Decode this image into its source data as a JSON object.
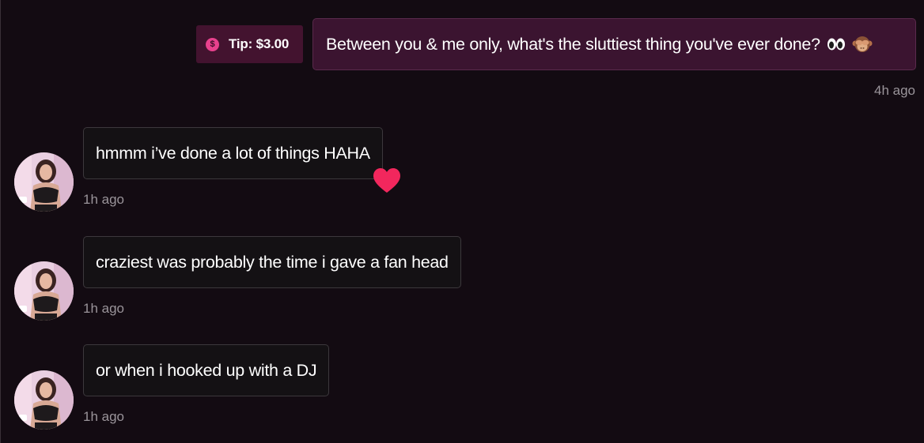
{
  "outgoing": {
    "tip_label": "Tip: $3.00",
    "tip_icon": "dollar-coin-icon",
    "message": "Between you & me only, what's the sluttiest thing you've ever done?",
    "emojis": [
      "eyes-emoji",
      "see-no-evil-monkey-emoji"
    ],
    "time": "4h ago"
  },
  "incoming": [
    {
      "text": "hmmm i’ve done a lot of things HAHA",
      "time": "1h ago",
      "reaction": "heart-icon"
    },
    {
      "text": "craziest was probably the time i gave a fan head",
      "time": "1h ago"
    },
    {
      "text": "or when i hooked up with a DJ",
      "time": "1h ago"
    }
  ],
  "colors": {
    "background": "#130b12",
    "outgoing_bubble": "#3b1430",
    "tip_badge": "#43132f",
    "accent_pink": "#e8418d",
    "heart": "#f2275d",
    "incoming_bubble": "#141114",
    "timestamp": "#9a949a"
  }
}
